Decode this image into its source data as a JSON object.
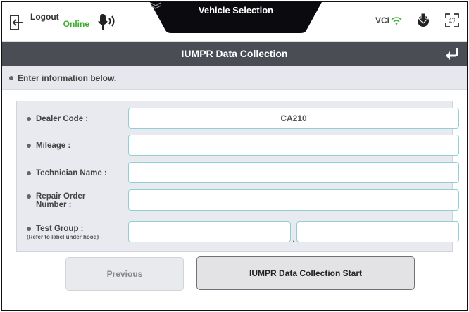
{
  "topbar": {
    "logout_label": "Logout",
    "online_label": "Online",
    "center_title": "Vehicle Selection",
    "vci_label": "VCI"
  },
  "titlebar": {
    "title": "IUMPR Data Collection"
  },
  "instruction": "Enter information below.",
  "form": {
    "dealer_code": {
      "label": "Dealer Code :",
      "value": "CA210"
    },
    "mileage": {
      "label": "Mileage :",
      "value": ""
    },
    "technician_name": {
      "label": "Technician Name :",
      "value": ""
    },
    "repair_order": {
      "label_line1": "Repair Order",
      "label_line2": "Number :",
      "value": ""
    },
    "test_group": {
      "label": "Test Group :",
      "note": "(Refer to label under hood)",
      "value1": "",
      "separator": ".",
      "value2": ""
    }
  },
  "buttons": {
    "previous": "Previous",
    "start": "IUMPR Data Collection Start"
  },
  "icons": {
    "logout": "logout-icon",
    "mic": "microphone-icon",
    "chevron": "chevron-down-icon",
    "wifi": "wifi-icon",
    "update": "update-download-icon",
    "fullscreen": "fullscreen-icon",
    "back": "back-arrow-icon"
  },
  "colors": {
    "online": "#3cae2c",
    "titlebar": "#4b4d54",
    "input_border": "#8fd0d6",
    "instruction_bg": "#e7e8ee"
  }
}
